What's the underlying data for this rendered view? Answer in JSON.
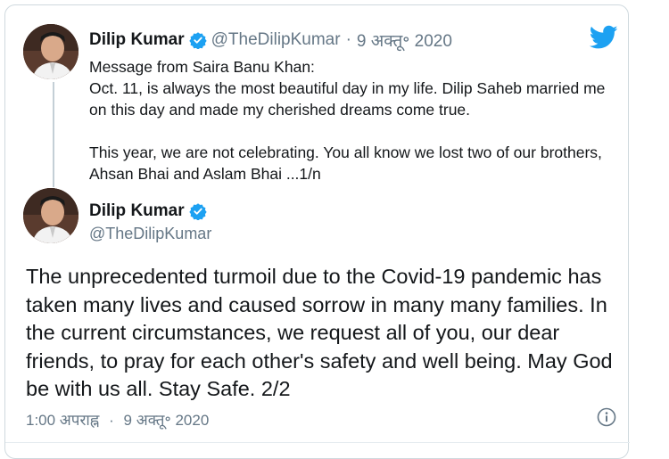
{
  "tweet1": {
    "name": "Dilip Kumar",
    "handle": "@TheDilipKumar",
    "separator": "·",
    "date": "9 अक्तू॰ 2020",
    "lines": [
      "Message from Saira Banu Khan:",
      "Oct. 11, is always the most beautiful day in my life. Dilip Saheb married me on this day and made my cherished dreams come true.",
      "",
      "This year, we are not celebrating. You all know we lost two of our brothers, Ahsan Bhai and Aslam Bhai ...1/n"
    ]
  },
  "tweet2": {
    "name": "Dilip Kumar",
    "handle": "@TheDilipKumar",
    "text": "The unprecedented turmoil due to the Covid-19 pandemic has taken many lives and caused sorrow in many many families. In the current circumstances, we request all of you, our dear friends, to pray for each other's safety and well being. May God be with us all. Stay Safe. 2/2",
    "time": "1:00 अपराह्न",
    "separator": "·",
    "date": "9 अक्तू॰ 2020"
  },
  "icons": {
    "verified": "verified-badge-icon",
    "brand": "twitter-bird-icon",
    "info": "info-icon"
  },
  "colors": {
    "twitter_blue": "#1da1f2",
    "text_primary": "#14171a",
    "text_secondary": "#657786",
    "border": "#cfd9de"
  }
}
